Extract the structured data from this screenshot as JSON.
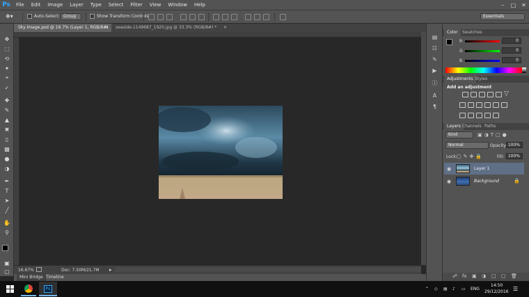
{
  "app": {
    "logo": "Ps",
    "brand_color": "#31a8ff"
  },
  "menu": {
    "items": [
      "File",
      "Edit",
      "Image",
      "Layer",
      "Type",
      "Select",
      "Filter",
      "View",
      "Window",
      "Help"
    ]
  },
  "options_bar": {
    "auto_select_label": "Auto-Select:",
    "auto_select_value": "Group",
    "show_transform_label": "Show Transform Controls",
    "workspace": "Essentials"
  },
  "doc_tabs": [
    {
      "label": "Sky Image.psd @ 16.7% (Layer 1, RGB/8#)",
      "active": true
    },
    {
      "label": "seaside-1149687_1920.jpg @ 33.3% (RGB/8#) *",
      "active": false
    }
  ],
  "status": {
    "zoom": "16.67%",
    "doc_size": "Doc: 7.50M/21.7M"
  },
  "bottom_tabs": [
    "Mini Bridge",
    "Timeline"
  ],
  "color_panel": {
    "tabs": [
      "Color",
      "Swatches"
    ],
    "channels": [
      {
        "label": "R",
        "value": "0"
      },
      {
        "label": "G",
        "value": "0"
      },
      {
        "label": "B",
        "value": "0"
      }
    ]
  },
  "adjustments_panel": {
    "tabs": [
      "Adjustments",
      "Styles"
    ],
    "heading": "Add an adjustment"
  },
  "layers_panel": {
    "tabs": [
      "Layers",
      "Channels",
      "Paths"
    ],
    "filter_kind": "Kind",
    "blend_mode": "Normal",
    "opacity_label": "Opacity:",
    "opacity_value": "100%",
    "lock_label": "Lock:",
    "fill_label": "Fill:",
    "fill_value": "100%",
    "layers": [
      {
        "name": "Layer 1",
        "selected": true
      },
      {
        "name": "Background",
        "selected": false
      }
    ]
  },
  "taskbar": {
    "language": "ENG",
    "time": "14:50",
    "date": "29/12/2016"
  }
}
